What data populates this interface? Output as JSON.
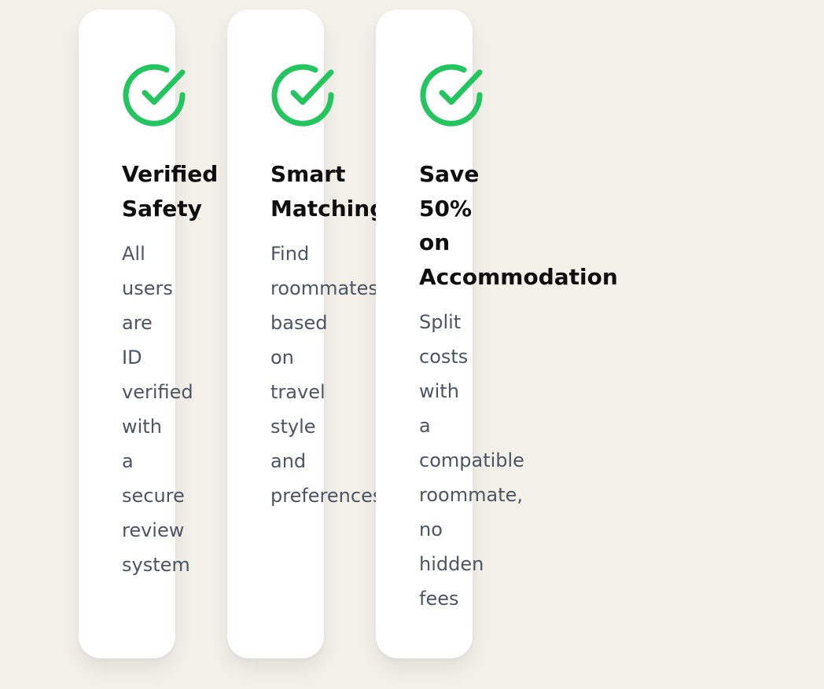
{
  "accent_color": "#22c55e",
  "cards": [
    {
      "icon": "check-circle-icon",
      "title": "Verified Safety",
      "description": "All users are ID verified with a secure review system"
    },
    {
      "icon": "check-circle-icon",
      "title": "Smart Matching",
      "description": "Find roommates based on travel style and preferences"
    },
    {
      "icon": "check-circle-icon",
      "title": "Save 50% on Accommodation",
      "description": "Split costs with a compatible roommate, no hidden fees"
    }
  ]
}
